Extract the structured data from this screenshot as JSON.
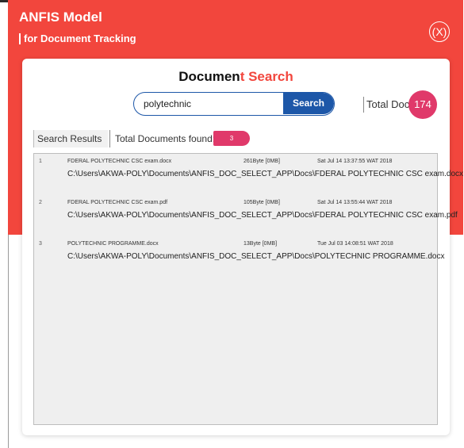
{
  "app": {
    "title": "ANFIS Model",
    "subtitle": "for Document Tracking",
    "close_label": "(X)"
  },
  "search": {
    "title_prefix": "Documen",
    "title_accent": "t Search",
    "query": "polytechnic",
    "button_label": "Search"
  },
  "totals": {
    "total_docs_label": "Total Docs",
    "total_docs_count": "174",
    "results_tab_label": "Search Results",
    "found_label": "Total Documents found:",
    "found_count": "3"
  },
  "results": [
    {
      "index": "1",
      "name": "FDERAL POLYTECHNIC CSC exam.docx",
      "size": "261Byte [0MB]",
      "date": "Sat Jul 14 13:37:55 WAT 2018",
      "path": "C:\\Users\\AKWA-POLY\\Documents\\ANFIS_DOC_SELECT_APP\\Docs\\FDERAL POLYTECHNIC CSC exam.docx"
    },
    {
      "index": "2",
      "name": "FDERAL POLYTECHNIC CSC exam.pdf",
      "size": "105Byte [0MB]",
      "date": "Sat Jul 14 13:55:44 WAT 2018",
      "path": "C:\\Users\\AKWA-POLY\\Documents\\ANFIS_DOC_SELECT_APP\\Docs\\FDERAL POLYTECHNIC CSC exam.pdf"
    },
    {
      "index": "3",
      "name": "POLYTECHNIC PROGRAMME.docx",
      "size": "13Byte [0MB]",
      "date": "Tue Jul 03 14:08:51 WAT 2018",
      "path": "C:\\Users\\AKWA-POLY\\Documents\\ANFIS_DOC_SELECT_APP\\Docs\\POLYTECHNIC PROGRAMME.docx"
    }
  ],
  "colors": {
    "banner": "#f2463d",
    "accent": "#f2463d",
    "search_button": "#1d57a8",
    "badge": "#e0396a"
  }
}
